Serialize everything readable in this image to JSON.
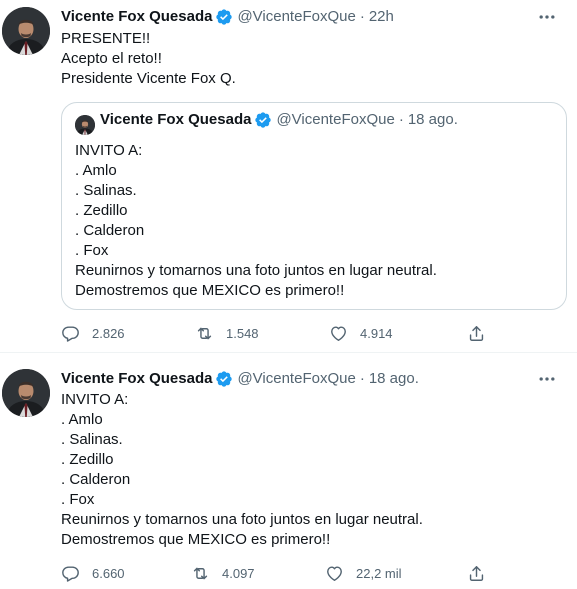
{
  "colors": {
    "text": "#0f1419",
    "secondary": "#536471",
    "verified": "#1d9bf0",
    "border": "#cfd9de"
  },
  "tweets": [
    {
      "author_name": "Vicente Fox Quesada",
      "handle": "@VicenteFoxQue",
      "separator": "·",
      "time": "22h",
      "lines": [
        "PRESENTE!!",
        "Acepto el reto!!",
        "Presidente Vicente Fox Q."
      ],
      "quote": {
        "author_name": "Vicente Fox Quesada",
        "handle": "@VicenteFoxQue",
        "separator": "·",
        "time": "18 ago.",
        "lines": [
          "INVITO A:",
          ". Amlo",
          ". Salinas.",
          ". Zedillo",
          ". Calderon",
          ". Fox",
          "Reunirnos y tomarnos una foto juntos en lugar neutral.",
          "Demostremos que MEXICO es primero!!"
        ]
      },
      "actions": {
        "replies": "2.826",
        "retweets": "1.548",
        "likes": "4.914"
      }
    },
    {
      "author_name": "Vicente Fox Quesada",
      "handle": "@VicenteFoxQue",
      "separator": "·",
      "time": "18 ago.",
      "lines": [
        "INVITO A:",
        ". Amlo",
        ". Salinas.",
        ". Zedillo",
        ". Calderon",
        ". Fox",
        "Reunirnos y tomarnos una foto juntos en lugar neutral.",
        "Demostremos que MEXICO es primero!!"
      ],
      "actions": {
        "replies": "6.660",
        "retweets": "4.097",
        "likes": "22,2 mil"
      }
    }
  ],
  "icons": {
    "verified": "verified-badge-icon",
    "more": "more-options-icon",
    "reply": "reply-icon",
    "retweet": "retweet-icon",
    "like": "like-icon",
    "share": "share-icon"
  }
}
